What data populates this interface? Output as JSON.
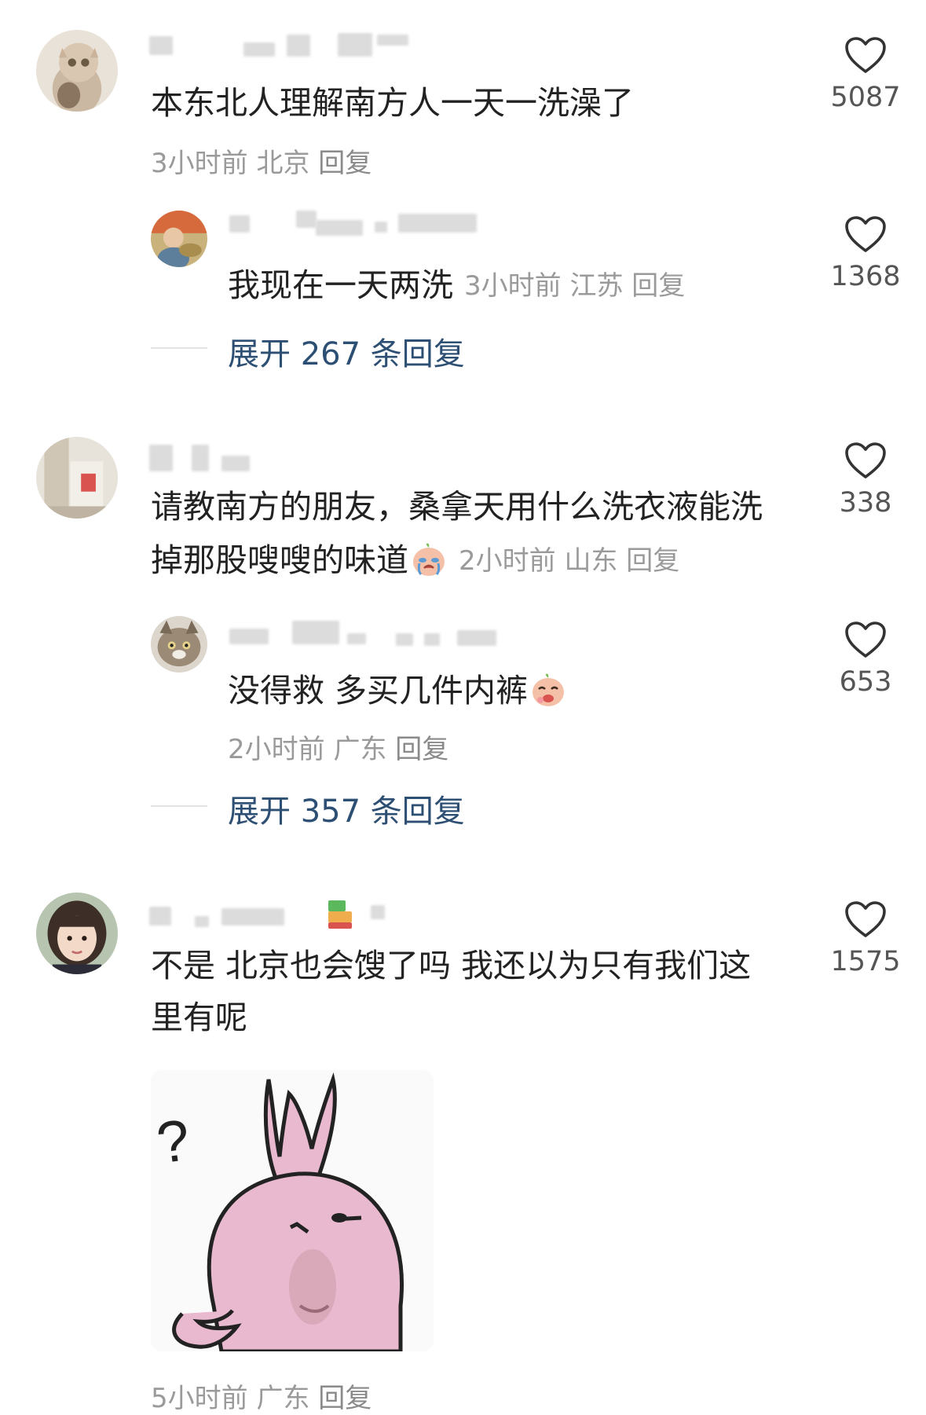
{
  "comments": [
    {
      "text": "本东北人理解南方人一天一洗澡了",
      "time": "3小时前",
      "location": "北京",
      "reply_label": "回复",
      "likes": "5087",
      "avatar": "cat-avatar"
    },
    {
      "text": "我现在一天两洗",
      "time": "3小时前",
      "location": "江苏",
      "reply_label": "回复",
      "likes": "1368",
      "avatar": "painting-avatar",
      "expand_label": "展开 267 条回复"
    },
    {
      "text_line1": "请教南方的朋友，桑拿天用什么洗衣液能洗",
      "text_line2": "掉那股嗖嗖的味道",
      "time": "2小时前",
      "location": "山东",
      "reply_label": "回复",
      "likes": "338",
      "avatar": "room-avatar",
      "emoji": "crying-peach-emoji"
    },
    {
      "text": "没得救 多买几件内裤",
      "time": "2小时前",
      "location": "广东",
      "reply_label": "回复",
      "likes": "653",
      "avatar": "tabby-cat-avatar",
      "emoji": "laughing-peach-emoji",
      "expand_label": "展开 357 条回复"
    },
    {
      "text_line1": "不是 北京也会馊了吗 我还以为只有我们这",
      "text_line2": "里有呢",
      "time": "5小时前",
      "location": "广东",
      "reply_label": "回复",
      "likes": "1575",
      "avatar": "girl-avatar",
      "sticker": "pink-rabbit-question-sticker",
      "sticker_question_mark": "?"
    }
  ],
  "colors": {
    "expand_link": "#2d4f73",
    "meta_gray": "#9a9a9a",
    "sticker_pink": "#e8b9cf"
  }
}
